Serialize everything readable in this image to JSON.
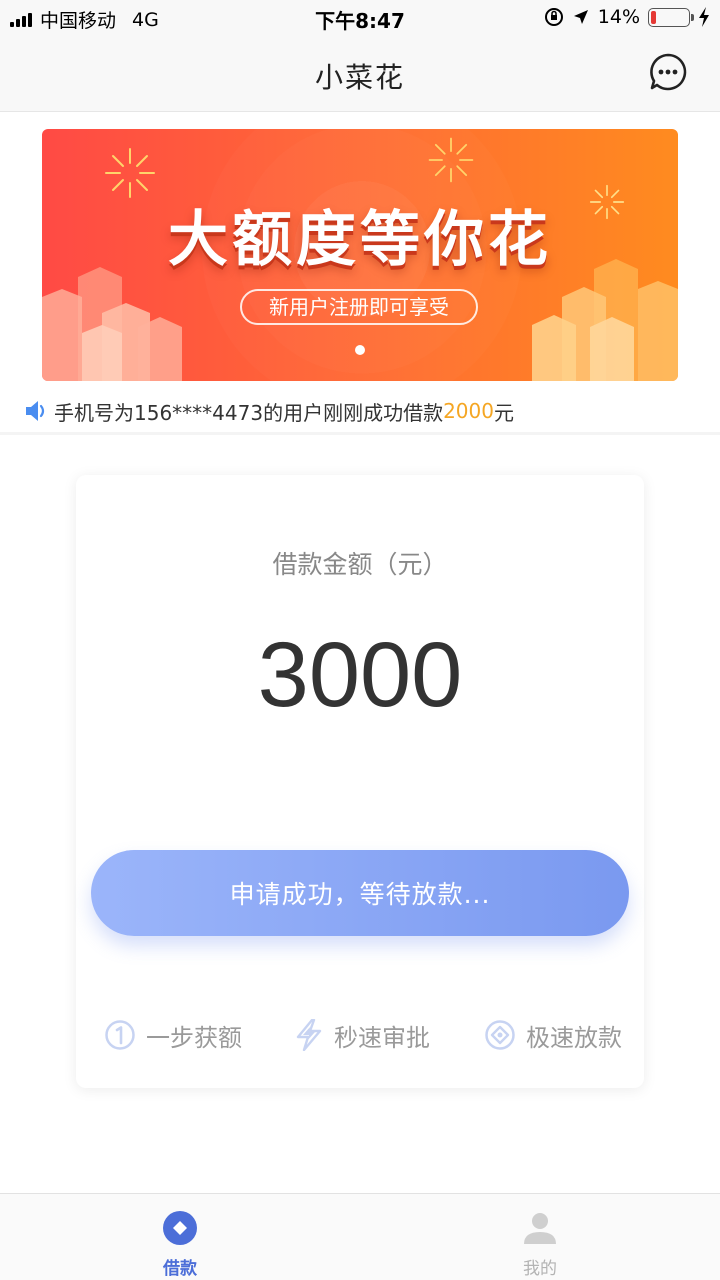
{
  "status_bar": {
    "carrier": "中国移动",
    "network": "4G",
    "time": "下午8:47",
    "battery": "14%",
    "battery_level": 0.14
  },
  "nav": {
    "title": "小菜花",
    "more_icon": "more-dots-icon"
  },
  "banner": {
    "headline": "大额度等你花",
    "subtitle": "新用户注册即可享受",
    "slide_count": 1,
    "active_slide": 1,
    "colors": {
      "start": "#ff4a45",
      "end": "#ff8b1f"
    }
  },
  "notice": {
    "icon": "speaker-icon",
    "prefix": "手机号为156****4473的用户刚刚成功借款",
    "amount": "2000",
    "suffix": "元",
    "amount_color": "#f5a623"
  },
  "loan": {
    "label": "借款金额（元）",
    "amount": "3000",
    "button_label": "申请成功，等待放款...",
    "button_color": "#7a99f0"
  },
  "features": [
    {
      "icon": "circle-one-icon",
      "label": "一步获额"
    },
    {
      "icon": "lightning-icon",
      "label": "秒速审批"
    },
    {
      "icon": "diamond-coin-icon",
      "label": "极速放款"
    }
  ],
  "tabs": [
    {
      "icon": "loan-tab-icon",
      "label": "借款",
      "active": true
    },
    {
      "icon": "user-tab-icon",
      "label": "我的",
      "active": false
    }
  ],
  "accent_color": "#4c6ed8"
}
